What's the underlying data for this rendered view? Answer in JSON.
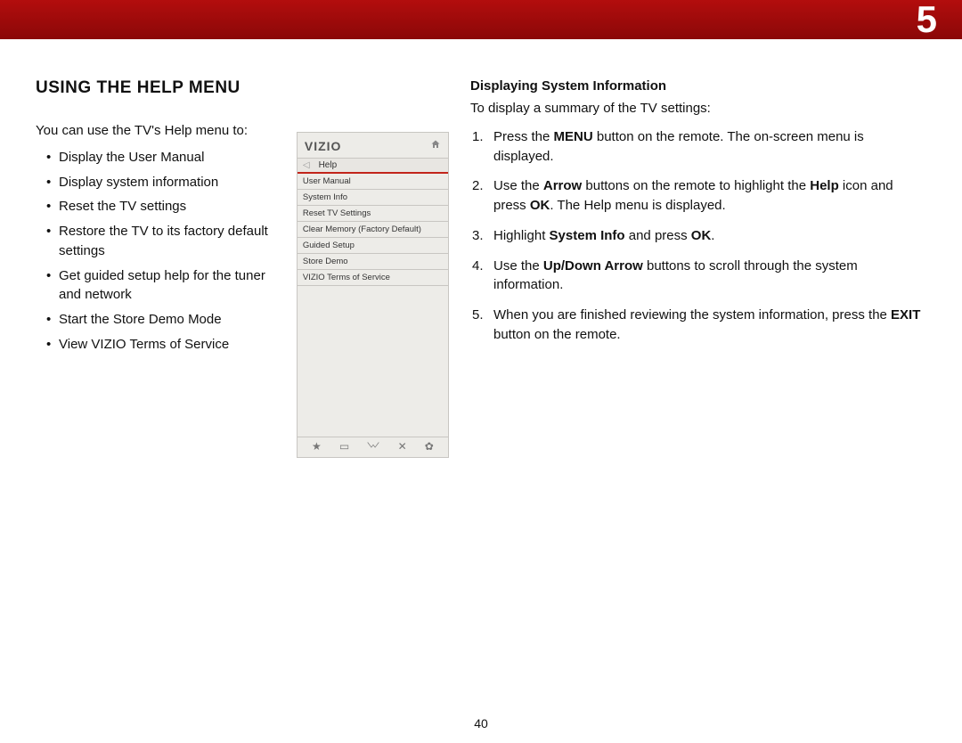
{
  "chapter_number": "5",
  "page_number": "40",
  "left": {
    "section_title": "USING THE HELP MENU",
    "intro": "You can use the TV's Help menu to:",
    "bullets": [
      "Display the User Manual",
      "Display system information",
      "Reset the TV settings",
      "Restore the TV to its factory default settings",
      "Get guided setup help for the tuner and network",
      "Start the Store Demo Mode",
      "View VIZIO Terms of Service"
    ]
  },
  "menu": {
    "brand": "VIZIO",
    "title": "Help",
    "items": [
      "User Manual",
      "System Info",
      "Reset TV Settings",
      "Clear Memory (Factory Default)",
      "Guided Setup",
      "Store Demo",
      "VIZIO Terms of Service"
    ]
  },
  "right": {
    "sub_heading": "Displaying System Information",
    "intro": "To display a summary of the TV settings:",
    "steps": [
      {
        "pre": "Press the ",
        "b1": "MENU",
        "mid1": " button on the remote. The on-screen menu is displayed."
      },
      {
        "pre": "Use the ",
        "b1": "Arrow",
        "mid1": " buttons on the remote to highlight the ",
        "b2": "Help",
        "mid2": " icon and press ",
        "b3": "OK",
        "mid3": ". The Help menu is displayed."
      },
      {
        "pre": "Highlight ",
        "b1": "System Info",
        "mid1": " and press ",
        "b2": "OK",
        "mid2": "."
      },
      {
        "pre": "Use the ",
        "b1": "Up/Down Arrow",
        "mid1": " buttons to scroll through the system information."
      },
      {
        "pre": "When you are finished reviewing the system information, press the ",
        "b1": "EXIT",
        "mid1": " button on the remote."
      }
    ]
  }
}
